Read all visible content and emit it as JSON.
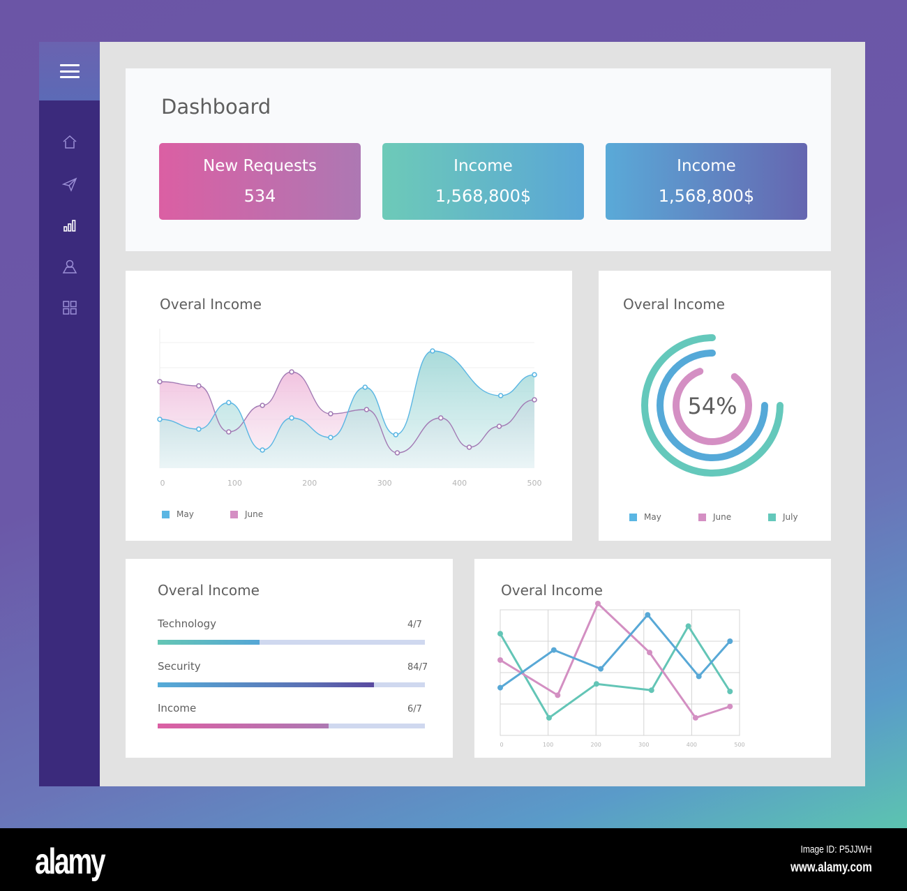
{
  "sidebar": {
    "menu_icon": "hamburger-menu-icon",
    "items": [
      {
        "name": "home",
        "icon": "home-icon",
        "active": false
      },
      {
        "name": "send",
        "icon": "paper-plane-icon",
        "active": false
      },
      {
        "name": "stats",
        "icon": "bar-chart-icon",
        "active": true
      },
      {
        "name": "profile",
        "icon": "user-icon",
        "active": false
      },
      {
        "name": "apps",
        "icon": "grid-icon",
        "active": false
      }
    ]
  },
  "header": {
    "title": "Dashboard",
    "stats": [
      {
        "label": "New Requests",
        "value": "534"
      },
      {
        "label": "Income",
        "value": "1,568,800$"
      },
      {
        "label": "Income",
        "value": "1,568,800$"
      }
    ]
  },
  "colors": {
    "may": "#5ab6e3",
    "june": "#d48fc3",
    "july": "#64c8bb",
    "blue_line": "#58a8d6",
    "pink_line": "#d38fc2",
    "teal_line": "#63c5b6",
    "text": "#5e5e5e"
  },
  "area_chart": {
    "title": "Overal Income",
    "legend": [
      "May",
      "June"
    ]
  },
  "donut_chart": {
    "title": "Overal Income",
    "center_label": "54%",
    "legend": [
      "May",
      "June",
      "July"
    ]
  },
  "progress": {
    "title": "Overal Income",
    "items": [
      {
        "label": "Technology",
        "value_text": "4/7",
        "fraction": 0.38
      },
      {
        "label": "Security",
        "value_text": "84/7",
        "fraction": 0.81
      },
      {
        "label": "Income",
        "value_text": "6/7",
        "fraction": 0.64
      }
    ]
  },
  "line_chart": {
    "title": "Overal Income"
  },
  "footer": {
    "logo": "alamy",
    "image_id": "Image ID: P5JJWH",
    "site": "www.alamy.com"
  },
  "chart_data": [
    {
      "type": "area",
      "title": "Overal Income",
      "xlabel": "",
      "ylabel": "",
      "xlim": [
        0,
        500
      ],
      "ylim": [
        0,
        100
      ],
      "xticks": [
        0,
        100,
        200,
        300,
        400,
        500
      ],
      "grid": true,
      "legend_position": "bottom-left",
      "series": [
        {
          "name": "May",
          "x": [
            0,
            52,
            92,
            137,
            176,
            228,
            274,
            315,
            364,
            455,
            500
          ],
          "y": [
            35,
            28,
            47,
            13,
            36,
            22,
            58,
            24,
            84,
            52,
            67
          ]
        },
        {
          "name": "June",
          "x": [
            0,
            52,
            92,
            137,
            176,
            228,
            276,
            317,
            375,
            413,
            453,
            500
          ],
          "y": [
            62,
            59,
            26,
            45,
            69,
            39,
            42,
            11,
            36,
            15,
            30,
            49
          ]
        }
      ]
    },
    {
      "type": "pie",
      "title": "Overal Income",
      "center_label": "54%",
      "legend_position": "bottom",
      "series": [
        {
          "name": "May",
          "fraction": 0.75
        },
        {
          "name": "June",
          "fraction": 0.84
        },
        {
          "name": "July",
          "fraction": 0.75
        }
      ]
    },
    {
      "type": "line",
      "title": "Overal Income",
      "xlim": [
        0,
        500
      ],
      "ylim": [
        0,
        100
      ],
      "xticks": [
        0,
        100,
        200,
        300,
        400,
        500
      ],
      "grid": true,
      "series": [
        {
          "name": "blue",
          "x": [
            0,
            112,
            210,
            308,
            415,
            480
          ],
          "y": [
            38,
            68,
            53,
            96,
            47,
            75
          ]
        },
        {
          "name": "pink",
          "x": [
            0,
            120,
            204,
            312,
            408,
            480
          ],
          "y": [
            60,
            32,
            105,
            66,
            14,
            23
          ]
        },
        {
          "name": "teal",
          "x": [
            0,
            102,
            201,
            316,
            393,
            480
          ],
          "y": [
            81,
            14,
            41,
            36,
            87,
            35
          ]
        }
      ]
    }
  ]
}
